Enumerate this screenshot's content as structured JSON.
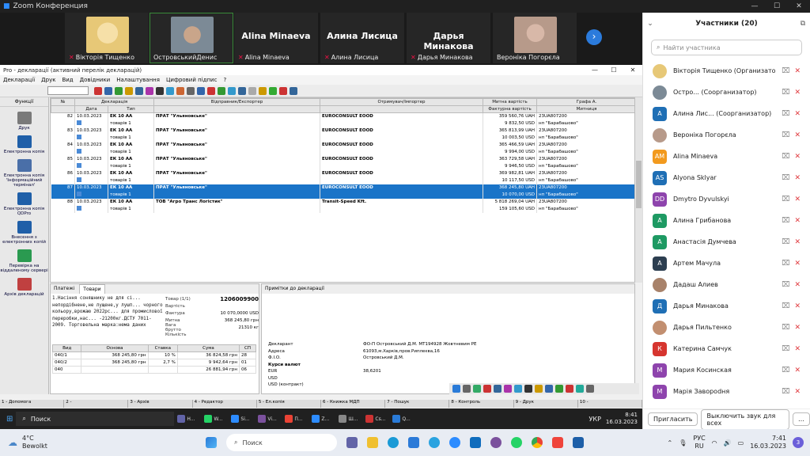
{
  "zoom": {
    "window_title": "Zoom Конференция",
    "video_tiles": [
      {
        "name": "Вікторія Тищенко",
        "muted": true,
        "photo": true,
        "photo_color": "#e7c877"
      },
      {
        "name": "ОстровськийДенис",
        "muted": false,
        "photo": true,
        "photo_color": "#7c8a96",
        "active": true
      },
      {
        "name": "Alina Minaeva",
        "muted": true,
        "big": "Alina Minaeva"
      },
      {
        "name": "Алина Лисица",
        "muted": true,
        "big": "Алина Лисица"
      },
      {
        "name": "Дарья Минакова",
        "muted": true,
        "big": "Дарья Минакова"
      },
      {
        "name": "Вероніка Погорєла",
        "muted": false,
        "photo": true,
        "photo_color": "#b79a8a"
      }
    ],
    "next_icon": "chevron-right-icon"
  },
  "participants": {
    "title": "Участники (20)",
    "search_placeholder": "Найти участника",
    "list": [
      {
        "name": "Вікторія Тищенко (Организатор, я)",
        "avatar": "photo",
        "color": "#e7c877"
      },
      {
        "name": "Остро... (Соорганизатор)",
        "avatar": "photo",
        "color": "#7c8a96"
      },
      {
        "name": "Алина Лис... (Соорганизатор)",
        "avatar": "А",
        "color": "#1f6fb5"
      },
      {
        "name": "Вероніка Погорєла",
        "avatar": "photo",
        "color": "#b79a8a"
      },
      {
        "name": "Alina Minaeva",
        "avatar": "AM",
        "color": "#f29a1e"
      },
      {
        "name": "Alyona Sklyar",
        "avatar": "AS",
        "color": "#1f6fb5"
      },
      {
        "name": "Dmytro Dyvulskyi",
        "avatar": "DD",
        "color": "#8e44ad"
      },
      {
        "name": "Алина Грибанова",
        "avatar": "А",
        "color": "#1e9a63"
      },
      {
        "name": "Анастасія Думчева",
        "avatar": "А",
        "color": "#1e9a63"
      },
      {
        "name": "Артем Мачула",
        "avatar": "А",
        "color": "#2c3e50"
      },
      {
        "name": "Дадаш Алиев",
        "avatar": "photo",
        "color": "#a8826a"
      },
      {
        "name": "Дарья Минакова",
        "avatar": "Д",
        "color": "#1f6fb5"
      },
      {
        "name": "Дарья Пильтенко",
        "avatar": "photo",
        "color": "#c28f70"
      },
      {
        "name": "Катерина Самчук",
        "avatar": "К",
        "color": "#d6352f"
      },
      {
        "name": "Мария Косинская",
        "avatar": "М",
        "color": "#8e44ad"
      },
      {
        "name": "Марія Заворodня",
        "avatar": "М",
        "color": "#8e44ad"
      }
    ],
    "invite_label": "Пригласить",
    "mute_all_label": "Выключить звук для всех"
  },
  "app": {
    "title": "Pro - декларації (активний перелік декларацій)",
    "menu": [
      "Декларації",
      "Друк",
      "Вид",
      "Довідники",
      "Налаштування",
      "Цифровий підпис",
      "?"
    ],
    "sidebar_label": "Функції",
    "sidebar": [
      "Друк",
      "Електронна копія",
      "Електронна копія 'Інформаційний термінал'",
      "Електронна копія QDPro",
      "Внесення з електронних копій",
      "Перевірка на віддаленому сервері",
      "Архів декларацій"
    ],
    "grid": {
      "headers": [
        "№",
        "Дата",
        "Тип",
        "Відправник/Експортер",
        "Отримувач/Імпортер",
        "Митна вартість",
        "Графа A."
      ],
      "group_header": "Декларація",
      "subheaders": [
        "Фактурна вартість",
        "Митниця"
      ],
      "rows": [
        {
          "n": "82",
          "date": "10.03.2023",
          "type": "ЕК 10 АА",
          "sender": "ПРАТ \"Ульяновське\"",
          "receiver": "EUROCONSULT EOOD",
          "v1": "359 560,76",
          "c1": "UAH",
          "v2": "9 832,50",
          "c2": "USD",
          "g1": "23UA807200",
          "g2": "нп \"Барабашово\""
        },
        {
          "n": "83",
          "date": "10.03.2023",
          "type": "ЕК 10 АА",
          "sender": "ПРАТ \"Ульяновське\"",
          "receiver": "EUROCONSULT EOOD",
          "v1": "365 813,99",
          "c1": "UAH",
          "v2": "10 003,50",
          "c2": "USD",
          "g1": "23UA807200",
          "g2": "нп \"Барабашово\""
        },
        {
          "n": "84",
          "date": "10.03.2023",
          "type": "ЕК 10 АА",
          "sender": "ПРАТ \"Ульяновське\"",
          "receiver": "EUROCONSULT EOOD",
          "v1": "365 466,59",
          "c1": "UAH",
          "v2": "9 994,00",
          "c2": "USD",
          "g1": "23UA807200",
          "g2": "нп \"Барабашово\""
        },
        {
          "n": "85",
          "date": "10.03.2023",
          "type": "ЕК 10 АА",
          "sender": "ПРАТ \"Ульяновське\"",
          "receiver": "EUROCONSULT EOOD",
          "v1": "363 729,58",
          "c1": "UAH",
          "v2": "9 946,50",
          "c2": "USD",
          "g1": "23UA807200",
          "g2": "нп \"Барабашово\""
        },
        {
          "n": "86",
          "date": "10.03.2023",
          "type": "ЕК 10 АА",
          "sender": "ПРАТ \"Ульяновське\"",
          "receiver": "EUROCONSULT EOOD",
          "v1": "369 982,81",
          "c1": "UAH",
          "v2": "10 117,50",
          "c2": "USD",
          "g1": "23UA807200",
          "g2": "нп \"Барабашово\""
        },
        {
          "n": "87",
          "date": "10.03.2023",
          "type": "ЕК 10 АА",
          "sender": "ПРАТ \"Ульяновське\"",
          "receiver": "EUROCONSULT EOOD",
          "v1": "368 245,80",
          "c1": "UAH",
          "v2": "10 070,00",
          "c2": "USD",
          "g1": "23UA807200",
          "g2": "нп \"Барабашово\"",
          "selected": true
        },
        {
          "n": "88",
          "date": "10.03.2023",
          "type": "ЕК 10 АА",
          "sender": "ТОВ \"Агро Транс Логістик\"",
          "receiver": "Transit-Speed Kft.",
          "v1": "5 818 269,04",
          "c1": "UAH",
          "v2": "159 105,60",
          "c2": "USD",
          "g1": "23UA807200",
          "g2": "нп \"Барабашово\""
        }
      ],
      "sub_text": "товарів 1"
    },
    "goods": {
      "tabs": [
        "Платежі",
        "Товари"
      ],
      "description": "1.Насіння соняшнику не для сі... непордібнене,не лущене,у лушп... чорного кольору,врожаю 2022рс... для промислової переробки,нас... -21200кг.ДСТУ 7011-2009. Торговельна марка:нема даних",
      "goods_label": "Товар (1/1)",
      "code": "1206009900",
      "rows": [
        {
          "k": "Вартість",
          "v": ""
        },
        {
          "k": "Фактура",
          "v": "10 070,0000 USD"
        },
        {
          "k": "Митна",
          "v": "368 245,80 грн"
        },
        {
          "k": "Вага брутто",
          "v": "21310 кг"
        },
        {
          "k": "Кількість",
          "v": ""
        }
      ],
      "duty_headers": [
        "Вид",
        "Основа",
        "Ставка",
        "Сума",
        "СП"
      ],
      "duties": [
        [
          "040/1",
          "368 245,80 грн",
          "10 %",
          "36 824,58 грн",
          "28"
        ],
        [
          "040/2",
          "368 245,80 грн",
          "2,7 %",
          "9 942,64 грн",
          "01"
        ],
        [
          "040",
          "",
          "",
          "26 881,94 грн",
          "06"
        ]
      ]
    },
    "notes": {
      "header": "Примітки до декларації",
      "rows": [
        {
          "k": "Декларант",
          "v": "ФО-П Островський Д.М. МТ194928 Жовтневим РЕ"
        },
        {
          "k": "Адреса",
          "v": "61093,м.Харків,пров.Риплеєва,16"
        },
        {
          "k": "Ф.І.О.",
          "v": "Островський Д.М."
        },
        {
          "k": "Курси валют",
          "v": ""
        },
        {
          "k": "EUR",
          "v": "38,6201"
        },
        {
          "k": "USD",
          "v": ""
        },
        {
          "k": "USD (контракт)",
          "v": ""
        }
      ]
    },
    "fkeys": [
      "1 - Допомога",
      "2 -",
      "3 - Архів",
      "4 - Редактор",
      "5 - Ел.копія",
      "6 - Книжка МДП",
      "7 - Пошук",
      "8 - Контроль",
      "9 - Друк",
      "10 -"
    ]
  },
  "inner_taskbar": {
    "search": "Поиск",
    "items": [
      "H...",
      "W...",
      "Si...",
      "Vi...",
      "П...",
      "Z...",
      "Ш...",
      "Cs...",
      "Q..."
    ],
    "lang": "УКР",
    "time": "8:41",
    "date": "16.03.2023"
  },
  "win_taskbar": {
    "temp": "4°C",
    "weather": "Bewolkt",
    "search": "Поиск",
    "lang1": "РУС",
    "lang2": "RU",
    "time": "7:41",
    "date": "16.03.2023",
    "badge": "3"
  }
}
